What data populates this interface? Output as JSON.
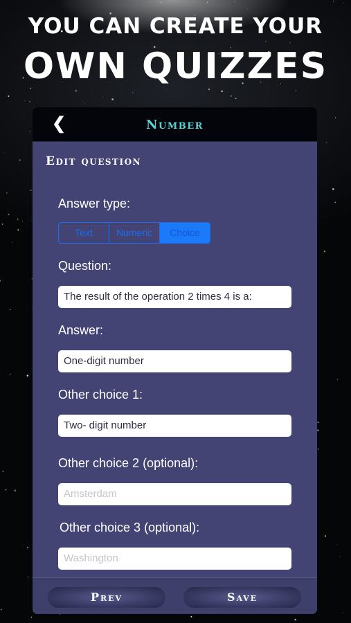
{
  "promo": {
    "line1": "You can create your",
    "line2": "own quizzes"
  },
  "navbar": {
    "back_icon": "chevron-left-icon",
    "title": "Number"
  },
  "section_title": "Edit question",
  "answer_type": {
    "label": "Answer type:",
    "options": [
      "Text",
      "Numeric",
      "Choice"
    ],
    "selected": "Choice"
  },
  "question": {
    "label": "Question:",
    "value": "The result of the operation 2 times 4 is a:"
  },
  "answer": {
    "label": "Answer:",
    "value": "One-digit number"
  },
  "other_choice_1": {
    "label": "Other choice 1:",
    "value": "Two- digit number"
  },
  "other_choice_2": {
    "label": "Other choice 2 (optional):",
    "placeholder": "Amsterdam"
  },
  "other_choice_3": {
    "label": "Other choice 3 (optional):",
    "placeholder": "Washington"
  },
  "buttons": {
    "prev": "Prev",
    "save": "Save"
  },
  "colors": {
    "panel": "#434473",
    "nav_title": "#56d4d4",
    "segment_accent": "#1a7af8"
  }
}
